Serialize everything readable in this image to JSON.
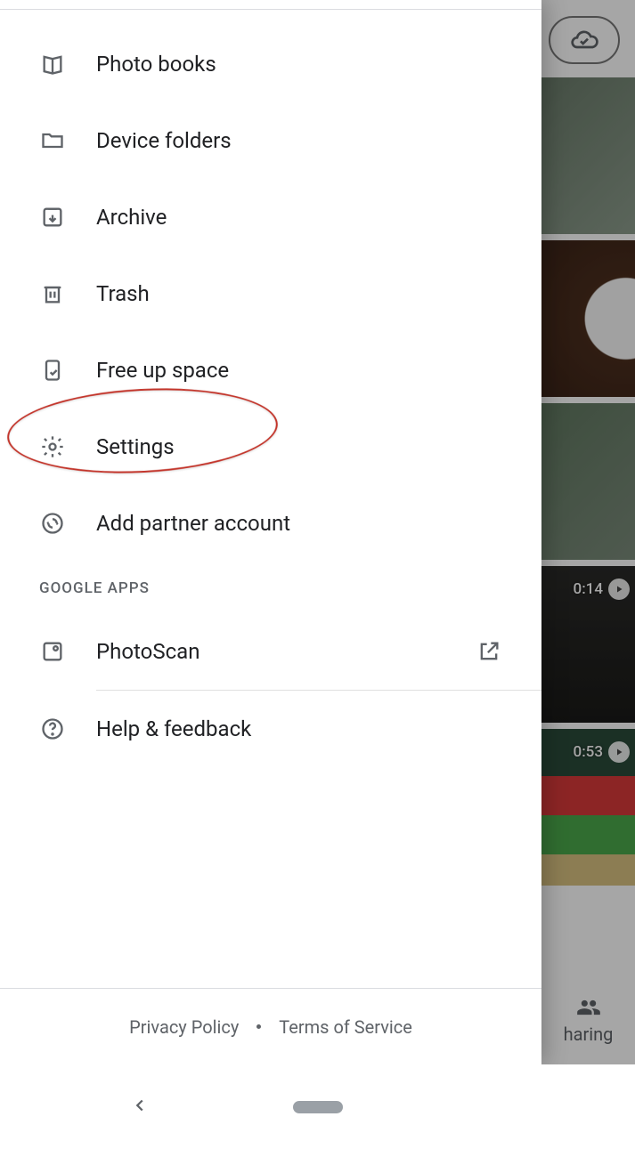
{
  "drawer": {
    "items": [
      {
        "label": "Photo books"
      },
      {
        "label": "Device folders"
      },
      {
        "label": "Archive"
      },
      {
        "label": "Trash"
      },
      {
        "label": "Free up space"
      },
      {
        "label": "Settings"
      },
      {
        "label": "Add partner account"
      }
    ],
    "section_header": "GOOGLE APPS",
    "apps": [
      {
        "label": "PhotoScan"
      }
    ],
    "help_label": "Help & feedback",
    "footer": {
      "privacy": "Privacy Policy",
      "terms": "Terms of Service"
    }
  },
  "background": {
    "videos": [
      {
        "duration": "0:14"
      },
      {
        "duration": "0:53"
      }
    ],
    "bottom_tab_partial": "haring"
  }
}
